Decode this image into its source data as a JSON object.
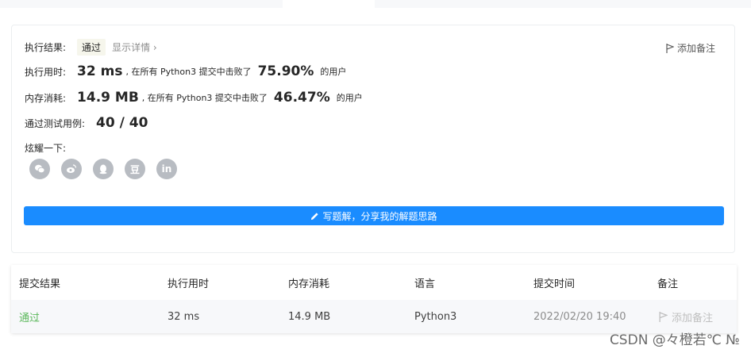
{
  "result": {
    "label": "执行结果:",
    "status": "通过",
    "detail_link": "显示详情 ›",
    "add_note": "添加备注"
  },
  "runtime": {
    "label": "执行用时:",
    "value": "32 ms",
    "mid": ", 在所有 Python3 提交中击败了",
    "percent": "75.90%",
    "suffix": "的用户"
  },
  "memory": {
    "label": "内存消耗:",
    "value": "14.9 MB",
    "mid": ", 在所有 Python3 提交中击败了",
    "percent": "46.47%",
    "suffix": "的用户"
  },
  "testcases": {
    "label": "通过测试用例:",
    "value": "40 / 40"
  },
  "share": {
    "label": "炫耀一下:",
    "buttons": [
      {
        "icon": "wechat-icon"
      },
      {
        "icon": "weibo-icon"
      },
      {
        "icon": "qq-icon"
      },
      {
        "icon": "douban-icon",
        "text": "豆"
      },
      {
        "icon": "linkedin-icon",
        "text": "in"
      }
    ]
  },
  "solution_button": "写题解，分享我的解题思路",
  "table": {
    "headers": [
      "提交结果",
      "执行用时",
      "内存消耗",
      "语言",
      "提交时间",
      "备注"
    ],
    "row": {
      "status": "通过",
      "runtime": "32 ms",
      "memory": "14.9 MB",
      "language": "Python3",
      "time": "2022/02/20 19:40",
      "note": "添加备注"
    }
  },
  "watermark": "CSDN @々橙若℃ №",
  "colors": {
    "accent": "#1a8cff",
    "success": "#5cb85c",
    "icon_gray": "#b8bcc2"
  }
}
